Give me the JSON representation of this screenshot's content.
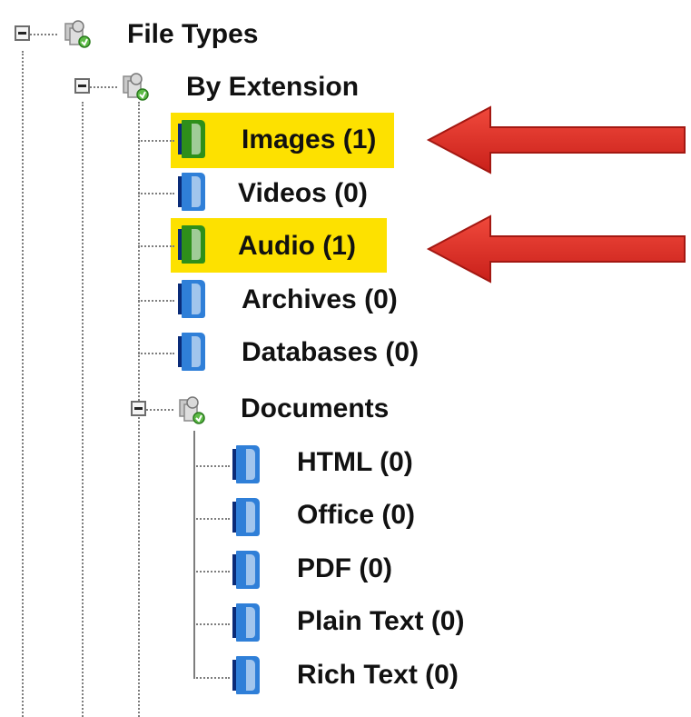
{
  "tree": {
    "root": {
      "label": "File Types",
      "icon": "file-types-folder-icon"
    },
    "by_extension": {
      "label": "By Extension",
      "icon": "category-folder-icon",
      "items": [
        {
          "label": "Images (1)",
          "count": 1,
          "highlighted": true,
          "icon_color": "green"
        },
        {
          "label": "Videos (0)",
          "count": 0,
          "highlighted": false,
          "icon_color": "blue"
        },
        {
          "label": "Audio (1)",
          "count": 1,
          "highlighted": true,
          "icon_color": "green"
        },
        {
          "label": "Archives (0)",
          "count": 0,
          "highlighted": false,
          "icon_color": "blue"
        },
        {
          "label": "Databases (0)",
          "count": 0,
          "highlighted": false,
          "icon_color": "blue"
        }
      ]
    },
    "documents": {
      "label": "Documents",
      "icon": "category-folder-icon",
      "items": [
        {
          "label": "HTML (0)",
          "count": 0,
          "icon_color": "blue"
        },
        {
          "label": "Office (0)",
          "count": 0,
          "icon_color": "blue"
        },
        {
          "label": "PDF (0)",
          "count": 0,
          "icon_color": "blue"
        },
        {
          "label": "Plain Text (0)",
          "count": 0,
          "icon_color": "blue"
        },
        {
          "label": "Rich Text (0)",
          "count": 0,
          "icon_color": "blue"
        }
      ]
    }
  },
  "annotations": {
    "arrow_color": "#e8322a",
    "highlight_color": "#fde100",
    "targets": [
      "Images (1)",
      "Audio (1)"
    ]
  },
  "colors": {
    "icon_green": "#2e8f1a",
    "icon_blue": "#2f7fd8",
    "tree_line": "#7d7d7d"
  }
}
